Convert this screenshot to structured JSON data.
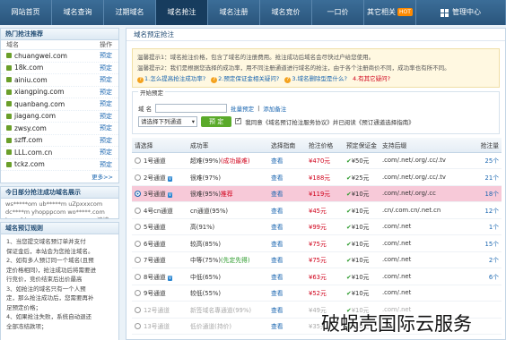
{
  "nav": {
    "items": [
      "网站首页",
      "域名查询",
      "过期域名",
      "域名抢注",
      "域名注册",
      "域名竞价",
      "一口价",
      "其它相关",
      "管理中心"
    ],
    "active_index": 3,
    "hot_badge": "HOT"
  },
  "hot": {
    "title": "热门抢注推荐",
    "col_domain": "域名",
    "col_action": "操作",
    "rows": [
      {
        "domain": "chuangwei.com",
        "action": "预定"
      },
      {
        "domain": "18k.com",
        "action": "预定"
      },
      {
        "domain": "ainiu.com",
        "action": "预定"
      },
      {
        "domain": "xiangping.com",
        "action": "预定"
      },
      {
        "domain": "quanbang.com",
        "action": "预定"
      },
      {
        "domain": "jiagang.com",
        "action": "预定"
      },
      {
        "domain": "zwsy.com",
        "action": "预定"
      },
      {
        "domain": "szff.com",
        "action": "预定"
      },
      {
        "domain": "LLL.com.cn",
        "action": "预定"
      },
      {
        "domain": "tckz.com",
        "action": "预定"
      }
    ],
    "more": "更多>>"
  },
  "success": {
    "title": "今日部分抢注成功域名展示",
    "text": "ws*****om    ub*****m  uZpxxxcom  dc****m  yhopppcom  wo*****.com  bmmfd.com  gnxxxx  asmeaasn  鸿博IP0906  yeatiedx  c0**ccll.com"
  },
  "rules": {
    "title": "域名预订规则",
    "lines": [
      "1、当您提交域名预订单并支付",
      "保证金后，本站会为您抢注域名。",
      "2、如有多人预订同一个域名(且预",
      "定价格相同)，抢注成功后将需要进",
      "行竞价，竞价结束后出价最高",
      "3、如抢注的域名只有一个人预",
      "定，那么抢注成功后，您需要再补",
      "足预定价格；",
      "4、如果抢注失败，系统自动退还",
      "全部冻结款项；"
    ]
  },
  "main": {
    "title": "域名预定抢注",
    "notice1": "温馨提示1：域名抢注价格，包含了域名的注册费用。抢注成功后域名会尽快过户给您使用。",
    "notice2_prefix": "温馨提示2：我们是根据您选择的成功率，用不同注册通道进行域名的抢注，由于各个注册商价不同，成功率也有所不同。",
    "links": [
      {
        "q": "?",
        "label": "1.怎么提高抢注成功率?"
      },
      {
        "q": "?",
        "label": "2.预定保证金相关疑问?"
      },
      {
        "q": "?",
        "label": "3.域名删除型是什么?"
      }
    ],
    "link_red": "4.有其它疑问?",
    "filter_legend": "开始预定",
    "domain_label": "域  名",
    "batch_label": "批量预定",
    "add_label": "添加备注",
    "select_label": "请选择下列通道",
    "submit_label": "预 定",
    "agree_text": "我同意《域名预订抢注服务协议》并已阅读《预订通道选择指南》",
    "agree_link": "《域名预订抢注服务协议》",
    "columns": [
      "请选择",
      "成功率",
      "选择指南",
      "抢注价格",
      "预定保证金",
      "支持后缀",
      "抢注量"
    ],
    "rows": [
      {
        "name": "1号通道",
        "rate": "超难(99%)",
        "tag": "(成功最难)",
        "tag_class": "tag-red",
        "guide": "查看",
        "price": "¥470元",
        "deposit": "¥50元",
        "suffix": ".com/.net/.org/.cc/.tv",
        "count": "25个",
        "vip": false,
        "checked": false,
        "hl": false,
        "dim": false
      },
      {
        "name": "2号通道",
        "rate": "很难(97%)",
        "tag": "",
        "tag_class": "",
        "guide": "查看",
        "price": "¥188元",
        "deposit": "¥25元",
        "suffix": ".com/.net/.org/.cc/.tv",
        "count": "21个",
        "vip": true,
        "checked": false,
        "hl": false,
        "dim": false
      },
      {
        "name": "3号通道",
        "rate": "很难(95%)",
        "tag": "推荐",
        "tag_class": "tag-red",
        "guide": "查看",
        "price": "¥119元",
        "deposit": "¥10元",
        "suffix": ".com/.net/.org/.cc",
        "count": "18个",
        "vip": true,
        "checked": true,
        "hl": true,
        "dim": false
      },
      {
        "name": "4号cn通道",
        "rate": "cn通道(95%)",
        "tag": "",
        "tag_class": "",
        "guide": "查看",
        "price": "¥45元",
        "deposit": "¥10元",
        "suffix": ".cn/.com.cn/.net.cn",
        "count": "12个",
        "vip": false,
        "checked": false,
        "hl": false,
        "dim": false
      },
      {
        "name": "5号通道",
        "rate": "高(91%)",
        "tag": "",
        "tag_class": "",
        "guide": "查看",
        "price": "¥99元",
        "deposit": "¥10元",
        "suffix": ".com/.net",
        "count": "1个",
        "vip": false,
        "checked": false,
        "hl": false,
        "dim": false
      },
      {
        "name": "6号通道",
        "rate": "较高(85%)",
        "tag": "",
        "tag_class": "",
        "guide": "查看",
        "price": "¥75元",
        "deposit": "¥10元",
        "suffix": ".com/.net",
        "count": "15个",
        "vip": false,
        "checked": false,
        "hl": false,
        "dim": false
      },
      {
        "name": "7号通道",
        "rate": "中等(75%)",
        "tag": "(先定先得)",
        "tag_class": "tag-green",
        "guide": "查看",
        "price": "¥75元",
        "deposit": "¥10元",
        "suffix": ".com/.net",
        "count": "2个",
        "vip": false,
        "checked": false,
        "hl": false,
        "dim": false
      },
      {
        "name": "8号通道",
        "rate": "中低(65%)",
        "tag": "",
        "tag_class": "",
        "guide": "查看",
        "price": "¥63元",
        "deposit": "¥10元",
        "suffix": ".com/.net",
        "count": "6个",
        "vip": true,
        "checked": false,
        "hl": false,
        "dim": false
      },
      {
        "name": "9号通道",
        "rate": "较低(55%)",
        "tag": "",
        "tag_class": "",
        "guide": "查看",
        "price": "¥52元",
        "deposit": "¥10元",
        "suffix": ".com/.net",
        "count": "",
        "vip": false,
        "checked": false,
        "hl": false,
        "dim": false
      },
      {
        "name": "12号通道",
        "rate": "新签域名專通道(99%)",
        "tag": "",
        "tag_class": "",
        "guide": "查看",
        "price": "¥49元",
        "deposit": "¥10元",
        "suffix": ".com/.net",
        "count": "",
        "vip": false,
        "checked": false,
        "hl": false,
        "dim": true
      },
      {
        "name": "13号通道",
        "rate": "低价通道(持价)",
        "tag": "",
        "tag_class": "",
        "guide": "查看",
        "price": "¥35元",
        "deposit": "¥10元",
        "suffix": "",
        "count": "",
        "vip": false,
        "checked": false,
        "hl": false,
        "dim": true
      }
    ]
  },
  "watermark": "破蜗壳国际云服务"
}
